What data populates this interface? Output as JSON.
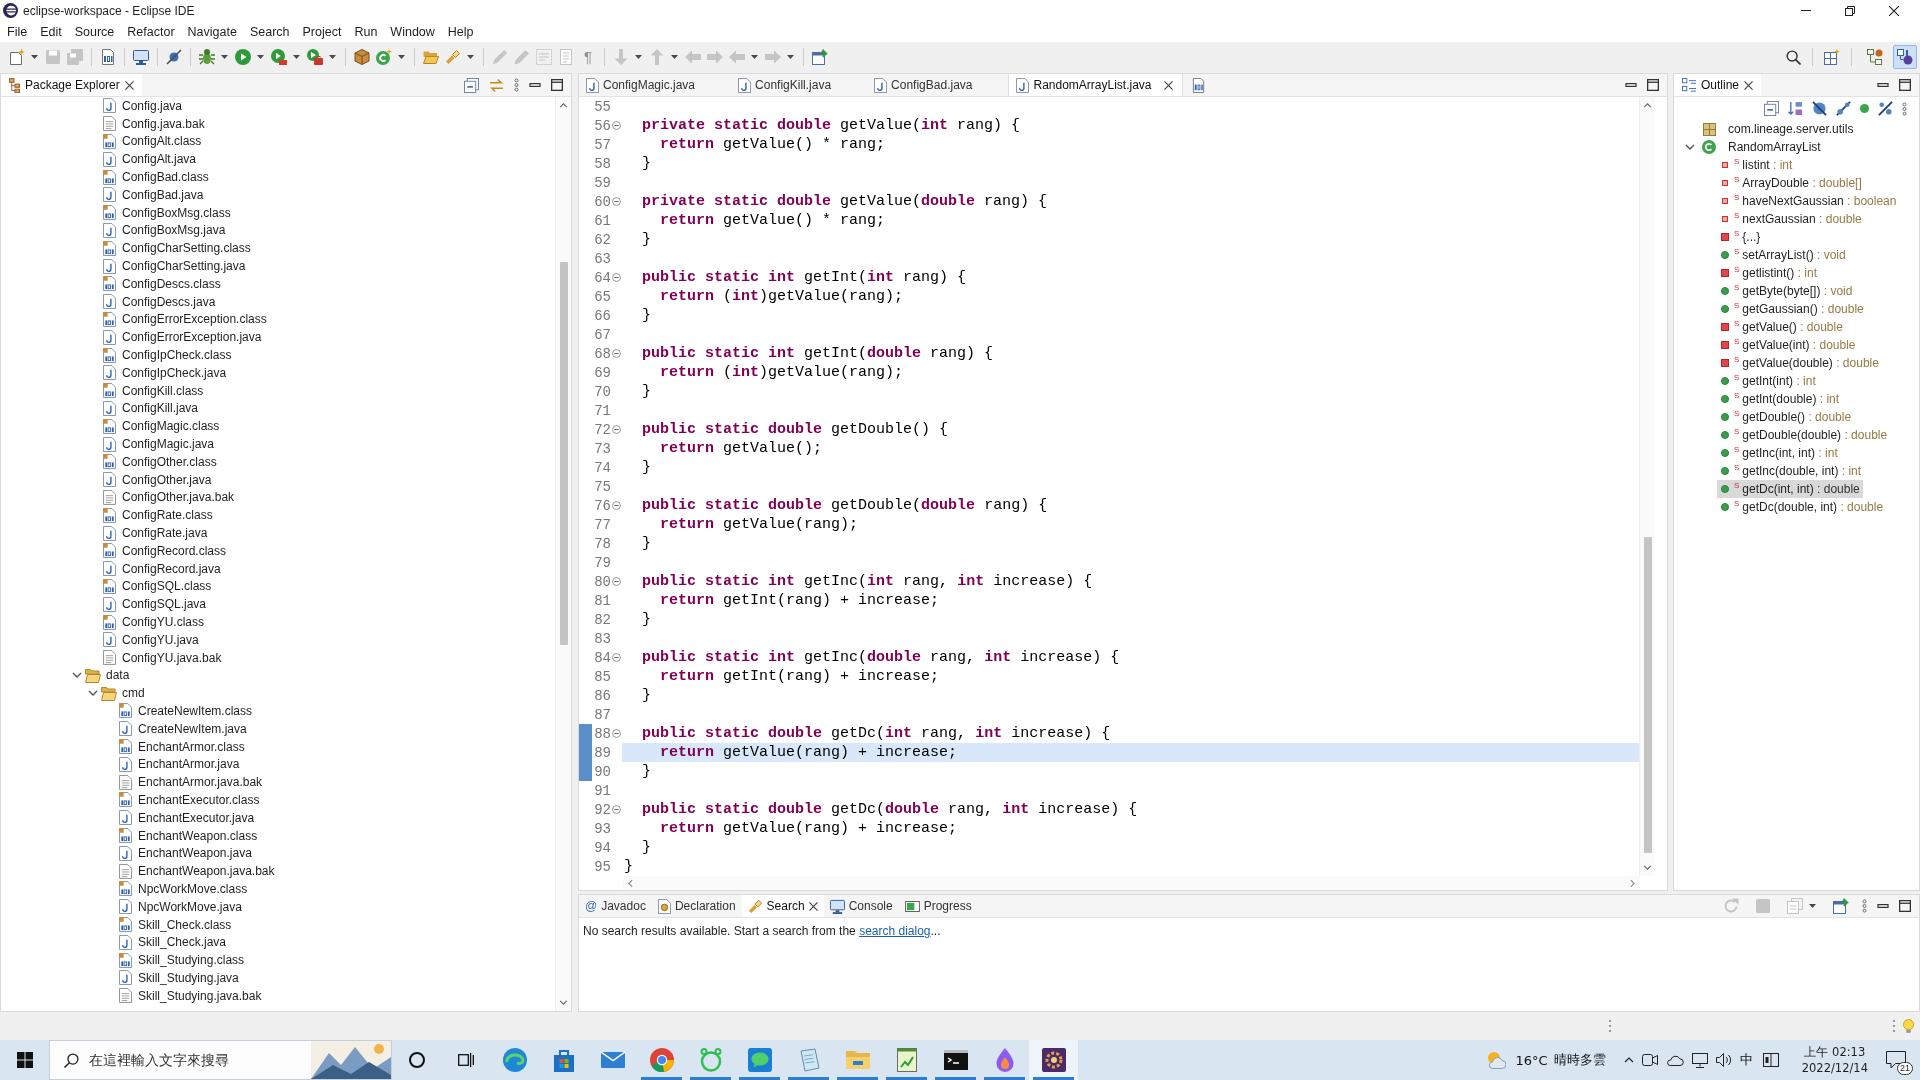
{
  "window": {
    "title": "eclipse-workspace - Eclipse IDE"
  },
  "menu": [
    "File",
    "Edit",
    "Source",
    "Refactor",
    "Navigate",
    "Search",
    "Project",
    "Run",
    "Window",
    "Help"
  ],
  "toolbar": [
    [
      {
        "kind": "new",
        "disabled": false,
        "dropdown": true
      },
      {
        "kind": "save",
        "disabled": true,
        "dropdown": false
      },
      {
        "kind": "saveall",
        "disabled": true,
        "dropdown": false
      }
    ],
    [
      {
        "kind": "binary",
        "disabled": false,
        "dropdown": false
      }
    ],
    [
      {
        "kind": "terminal",
        "disabled": false,
        "dropdown": false
      }
    ],
    [
      {
        "kind": "skip",
        "disabled": false,
        "dropdown": false
      }
    ],
    [
      {
        "kind": "debug",
        "disabled": false,
        "dropdown": true
      },
      {
        "kind": "run",
        "disabled": false,
        "dropdown": true
      },
      {
        "kind": "coverage",
        "disabled": false,
        "dropdown": true
      },
      {
        "kind": "tools",
        "disabled": false,
        "dropdown": true
      }
    ],
    [
      {
        "kind": "package",
        "disabled": false,
        "dropdown": false
      },
      {
        "kind": "newclass",
        "disabled": false,
        "dropdown": true
      }
    ],
    [
      {
        "kind": "opentype",
        "disabled": false,
        "dropdown": false
      },
      {
        "kind": "search",
        "disabled": false,
        "dropdown": true
      }
    ],
    [
      {
        "kind": "mark",
        "disabled": true,
        "dropdown": false
      },
      {
        "kind": "pen",
        "disabled": true,
        "dropdown": false
      },
      {
        "kind": "block",
        "disabled": true,
        "dropdown": false
      },
      {
        "kind": "page",
        "disabled": true,
        "dropdown": false
      },
      {
        "kind": "glyph",
        "glyph": "¶",
        "disabled": true,
        "dropdown": false
      }
    ],
    [
      {
        "kind": "down",
        "disabled": true,
        "dropdown": true
      },
      {
        "kind": "up",
        "disabled": true,
        "dropdown": true
      },
      {
        "kind": "lastedit",
        "disabled": true,
        "dropdown": false
      },
      {
        "kind": "nextedit",
        "disabled": true,
        "dropdown": false
      },
      {
        "kind": "back",
        "disabled": true,
        "dropdown": true
      },
      {
        "kind": "forward",
        "disabled": true,
        "dropdown": true
      }
    ],
    [
      {
        "kind": "pin",
        "disabled": false,
        "dropdown": false
      }
    ]
  ],
  "perspectives": [
    {
      "kind": "javaee",
      "selected": false
    },
    {
      "kind": "java",
      "selected": true
    }
  ],
  "package_explorer": {
    "tabs": [
      {
        "label": "Package Explorer",
        "selected": true
      }
    ],
    "tree": [
      {
        "children": [
          {
            "label": "Config.java",
            "kind": "java"
          },
          {
            "label": "Config.java.bak",
            "kind": "text"
          },
          {
            "label": "ConfigAlt.class",
            "kind": "class"
          },
          {
            "label": "ConfigAlt.java",
            "kind": "java"
          },
          {
            "label": "ConfigBad.class",
            "kind": "class"
          },
          {
            "label": "ConfigBad.java",
            "kind": "java"
          },
          {
            "label": "ConfigBoxMsg.class",
            "kind": "class"
          },
          {
            "label": "ConfigBoxMsg.java",
            "kind": "java"
          },
          {
            "label": "ConfigCharSetting.class",
            "kind": "class"
          },
          {
            "label": "ConfigCharSetting.java",
            "kind": "java"
          },
          {
            "label": "ConfigDescs.class",
            "kind": "class"
          },
          {
            "label": "ConfigDescs.java",
            "kind": "java"
          },
          {
            "label": "ConfigErrorException.class",
            "kind": "class"
          },
          {
            "label": "ConfigErrorException.java",
            "kind": "java"
          },
          {
            "label": "ConfigIpCheck.class",
            "kind": "class"
          },
          {
            "label": "ConfigIpCheck.java",
            "kind": "java"
          },
          {
            "label": "ConfigKill.class",
            "kind": "class"
          },
          {
            "label": "ConfigKill.java",
            "kind": "java"
          },
          {
            "label": "ConfigMagic.class",
            "kind": "class"
          },
          {
            "label": "ConfigMagic.java",
            "kind": "java"
          },
          {
            "label": "ConfigOther.class",
            "kind": "class"
          },
          {
            "label": "ConfigOther.java",
            "kind": "java"
          },
          {
            "label": "ConfigOther.java.bak",
            "kind": "text"
          },
          {
            "label": "ConfigRate.class",
            "kind": "class"
          },
          {
            "label": "ConfigRate.java",
            "kind": "java"
          },
          {
            "label": "ConfigRecord.class",
            "kind": "class"
          },
          {
            "label": "ConfigRecord.java",
            "kind": "java"
          },
          {
            "label": "ConfigSQL.class",
            "kind": "class"
          },
          {
            "label": "ConfigSQL.java",
            "kind": "java"
          },
          {
            "label": "ConfigYU.class",
            "kind": "class"
          },
          {
            "label": "ConfigYU.java",
            "kind": "java"
          },
          {
            "label": "ConfigYU.java.bak",
            "kind": "text"
          }
        ]
      },
      {
        "label": "data",
        "kind": "folder",
        "expanded": true,
        "children": [
          {
            "label": "cmd",
            "kind": "folder",
            "expanded": true,
            "children": [
              {
                "label": "CreateNewItem.class",
                "kind": "class"
              },
              {
                "label": "CreateNewItem.java",
                "kind": "java"
              },
              {
                "label": "EnchantArmor.class",
                "kind": "class"
              },
              {
                "label": "EnchantArmor.java",
                "kind": "java"
              },
              {
                "label": "EnchantArmor.java.bak",
                "kind": "text"
              },
              {
                "label": "EnchantExecutor.class",
                "kind": "class"
              },
              {
                "label": "EnchantExecutor.java",
                "kind": "java"
              },
              {
                "label": "EnchantWeapon.class",
                "kind": "class"
              },
              {
                "label": "EnchantWeapon.java",
                "kind": "java"
              },
              {
                "label": "EnchantWeapon.java.bak",
                "kind": "text"
              },
              {
                "label": "NpcWorkMove.class",
                "kind": "class"
              },
              {
                "label": "NpcWorkMove.java",
                "kind": "java"
              },
              {
                "label": "Skill_Check.class",
                "kind": "class"
              },
              {
                "label": "Skill_Check.java",
                "kind": "java"
              },
              {
                "label": "Skill_Studying.class",
                "kind": "class"
              },
              {
                "label": "Skill_Studying.java",
                "kind": "java"
              },
              {
                "label": "Skill_Studying.java.bak",
                "kind": "text"
              }
            ]
          }
        ]
      }
    ]
  },
  "editor": {
    "tabs": [
      {
        "label": "ConfigMagic.java",
        "selected": false
      },
      {
        "label": "ConfigKill.java",
        "selected": false
      },
      {
        "label": "ConfigBad.java",
        "selected": false
      },
      {
        "label": "RandomArrayList.java",
        "selected": true
      }
    ],
    "lines": [
      {
        "number": "55",
        "fold": false,
        "current": false,
        "range": false
      },
      {
        "number": "56",
        "code": "  **private** **static** **double** getValue(**int** rang) {",
        "fold": true,
        "current": false,
        "range": false
      },
      {
        "number": "57",
        "code": "    **return** getValue() * rang;",
        "fold": false,
        "current": false,
        "range": false
      },
      {
        "number": "58",
        "code": "  }",
        "fold": false,
        "current": false,
        "range": false
      },
      {
        "number": "59",
        "fold": false,
        "current": false,
        "range": false
      },
      {
        "number": "60",
        "code": "  **private** **static** **double** getValue(**double** rang) {",
        "fold": true,
        "current": false,
        "range": false
      },
      {
        "number": "61",
        "code": "    **return** getValue() * rang;",
        "fold": false,
        "current": false,
        "range": false
      },
      {
        "number": "62",
        "code": "  }",
        "fold": false,
        "current": false,
        "range": false
      },
      {
        "number": "63",
        "fold": false,
        "current": false,
        "range": false
      },
      {
        "number": "64",
        "code": "  **public** **static** **int** getInt(**int** rang) {",
        "fold": true,
        "current": false,
        "range": false
      },
      {
        "number": "65",
        "code": "    **return** (**int**)getValue(rang);",
        "fold": false,
        "current": false,
        "range": false
      },
      {
        "number": "66",
        "code": "  }",
        "fold": false,
        "current": false,
        "range": false
      },
      {
        "number": "67",
        "fold": false,
        "current": false,
        "range": false
      },
      {
        "number": "68",
        "code": "  **public** **static** **int** getInt(**double** rang) {",
        "fold": true,
        "current": false,
        "range": false
      },
      {
        "number": "69",
        "code": "    **return** (**int**)getValue(rang);",
        "fold": false,
        "current": false,
        "range": false
      },
      {
        "number": "70",
        "code": "  }",
        "fold": false,
        "current": false,
        "range": false
      },
      {
        "number": "71",
        "fold": false,
        "current": false,
        "range": false
      },
      {
        "number": "72",
        "code": "  **public** **static** **double** getDouble() {",
        "fold": true,
        "current": false,
        "range": false
      },
      {
        "number": "73",
        "code": "    **return** getValue();",
        "fold": false,
        "current": false,
        "range": false
      },
      {
        "number": "74",
        "code": "  }",
        "fold": false,
        "current": false,
        "range": false
      },
      {
        "number": "75",
        "fold": false,
        "current": false,
        "range": false
      },
      {
        "number": "76",
        "code": "  **public** **static** **double** getDouble(**double** rang) {",
        "fold": true,
        "current": false,
        "range": false
      },
      {
        "number": "77",
        "code": "    **return** getValue(rang);",
        "fold": false,
        "current": false,
        "range": false
      },
      {
        "number": "78",
        "code": "  }",
        "fold": false,
        "current": false,
        "range": false
      },
      {
        "number": "79",
        "fold": false,
        "current": false,
        "range": false
      },
      {
        "number": "80",
        "code": "  **public** **static** **int** getInc(**int** rang, **int** increase) {",
        "fold": true,
        "current": false,
        "range": false
      },
      {
        "number": "81",
        "code": "    **return** getInt(rang) + increase;",
        "fold": false,
        "current": false,
        "range": false
      },
      {
        "number": "82",
        "code": "  }",
        "fold": false,
        "current": false,
        "range": false
      },
      {
        "number": "83",
        "fold": false,
        "current": false,
        "range": false
      },
      {
        "number": "84",
        "code": "  **public** **static** **int** getInc(**double** rang, **int** increase) {",
        "fold": true,
        "current": false,
        "range": false
      },
      {
        "number": "85",
        "code": "    **return** getInt(rang) + increase;",
        "fold": false,
        "current": false,
        "range": false
      },
      {
        "number": "86",
        "code": "  }",
        "fold": false,
        "current": false,
        "range": false
      },
      {
        "number": "87",
        "fold": false,
        "current": false,
        "range": false
      },
      {
        "number": "88",
        "code": "  **public** **static** **double** getDc(**int** rang, **int** increase) {",
        "fold": true,
        "current": false,
        "range": true
      },
      {
        "number": "89",
        "code": "    **return** getValue(rang) + increase;",
        "fold": false,
        "current": true,
        "range": true
      },
      {
        "number": "90",
        "code": "  }",
        "fold": false,
        "current": false,
        "range": true
      },
      {
        "number": "91",
        "fold": false,
        "current": false,
        "range": false
      },
      {
        "number": "92",
        "code": "  **public** **static** **double** getDc(**double** rang, **int** increase) {",
        "fold": true,
        "current": false,
        "range": false
      },
      {
        "number": "93",
        "code": "    **return** getValue(rang) + increase;",
        "fold": false,
        "current": false,
        "range": false
      },
      {
        "number": "94",
        "code": "  }",
        "fold": false,
        "current": false,
        "range": false
      },
      {
        "number": "95",
        "code": "}",
        "fold": false,
        "current": false,
        "range": false
      }
    ]
  },
  "outline": {
    "tabs": [
      {
        "label": "Outline",
        "selected": true
      }
    ],
    "tree": [
      {
        "label": "com.lineage.server.utils",
        "kind": "package",
        "selected": false
      },
      {
        "label": "RandomArrayList",
        "kind": "class",
        "expanded": true,
        "selected": false,
        "children": [
          {
            "label": "listint",
            "type": ": int",
            "kind": "field",
            "public": false,
            "modifier": "S",
            "selected": false
          },
          {
            "label": "ArrayDouble",
            "type": ": double[]",
            "kind": "field",
            "public": false,
            "modifier": "S",
            "selected": false
          },
          {
            "label": "haveNextGaussian",
            "type": ": boolean",
            "kind": "field",
            "public": false,
            "modifier": "S",
            "selected": false
          },
          {
            "label": "nextGaussian",
            "type": ": double",
            "kind": "field",
            "public": false,
            "modifier": "S",
            "selected": false
          },
          {
            "label": "{...}",
            "kind": "initializer",
            "public": false,
            "modifier": "S",
            "selected": false
          },
          {
            "label": "setArrayList()",
            "type": ": void",
            "kind": "method",
            "public": true,
            "modifier": "S",
            "selected": false
          },
          {
            "label": "getlistint()",
            "type": ": int",
            "kind": "method",
            "public": false,
            "modifier": "S",
            "selected": false
          },
          {
            "label": "getByte(byte[])",
            "type": ": void",
            "kind": "method",
            "public": true,
            "modifier": "S",
            "selected": false
          },
          {
            "label": "getGaussian()",
            "type": ": double",
            "kind": "method",
            "public": true,
            "modifier": "S",
            "selected": false
          },
          {
            "label": "getValue()",
            "type": ": double",
            "kind": "method",
            "public": false,
            "modifier": "S",
            "selected": false
          },
          {
            "label": "getValue(int)",
            "type": ": double",
            "kind": "method",
            "public": false,
            "modifier": "S",
            "selected": false
          },
          {
            "label": "getValue(double)",
            "type": ": double",
            "kind": "method",
            "public": false,
            "modifier": "S",
            "selected": false
          },
          {
            "label": "getInt(int)",
            "type": ": int",
            "kind": "method",
            "public": true,
            "modifier": "S",
            "selected": false
          },
          {
            "label": "getInt(double)",
            "type": ": int",
            "kind": "method",
            "public": true,
            "modifier": "S",
            "selected": false
          },
          {
            "label": "getDouble()",
            "type": ": double",
            "kind": "method",
            "public": true,
            "modifier": "S",
            "selected": false
          },
          {
            "label": "getDouble(double)",
            "type": ": double",
            "kind": "method",
            "public": true,
            "modifier": "S",
            "selected": false
          },
          {
            "label": "getInc(int, int)",
            "type": ": int",
            "kind": "method",
            "public": true,
            "modifier": "S",
            "selected": false
          },
          {
            "label": "getInc(double, int)",
            "type": ": int",
            "kind": "method",
            "public": true,
            "modifier": "S",
            "selected": false
          },
          {
            "label": "getDc(int, int)",
            "type": ": double",
            "kind": "method",
            "public": true,
            "modifier": "S",
            "selected": true
          },
          {
            "label": "getDc(double, int)",
            "type": ": double",
            "kind": "method",
            "public": true,
            "modifier": "S",
            "selected": false
          }
        ]
      }
    ]
  },
  "bottom_panel": {
    "tabs": [
      {
        "label": "Javadoc",
        "kind": "javadoc",
        "glyph": "@",
        "selected": false
      },
      {
        "label": "Declaration",
        "kind": "declaration",
        "selected": false
      },
      {
        "label": "Search",
        "kind": "search",
        "selected": true
      },
      {
        "label": "Console",
        "kind": "console",
        "selected": false
      },
      {
        "label": "Progress",
        "kind": "progress",
        "selected": false
      }
    ],
    "toolbar": [
      {
        "kind": "refresh",
        "disabled": true,
        "dropdown": false
      },
      {
        "kind": "stop",
        "disabled": true,
        "dropdown": false
      },
      {
        "kind": "history",
        "disabled": true,
        "dropdown": true
      },
      {
        "kind": "pin",
        "disabled": false,
        "dropdown": false
      }
    ],
    "message": {
      "text": "No search results available. Start a search from the ",
      "link": "search dialog",
      "after": "..."
    }
  },
  "taskbar": {
    "search": {
      "placeholder": "在這裡輸入文字來搜尋"
    },
    "apps": [
      {
        "kind": "edge",
        "running": false,
        "selected": false
      },
      {
        "kind": "store",
        "running": false,
        "selected": false
      },
      {
        "kind": "mail",
        "running": false,
        "selected": false
      },
      {
        "kind": "chrome",
        "running": true,
        "selected": false
      },
      {
        "kind": "ring",
        "running": true,
        "selected": false
      },
      {
        "kind": "line",
        "running": true,
        "selected": false
      },
      {
        "kind": "notepad",
        "running": true,
        "selected": false
      },
      {
        "kind": "files",
        "running": true,
        "selected": false
      },
      {
        "kind": "chart",
        "running": true,
        "selected": false
      },
      {
        "kind": "terminal",
        "running": true,
        "selected": false
      },
      {
        "kind": "flame",
        "running": true,
        "selected": false
      },
      {
        "kind": "game",
        "running": true,
        "selected": true
      }
    ],
    "weather": {
      "temperature": "16°C",
      "condition": "晴時多雲"
    },
    "input_method": "中",
    "clock": {
      "time": "上午 02:13",
      "date": "2022/12/14"
    },
    "notifications": "21"
  }
}
